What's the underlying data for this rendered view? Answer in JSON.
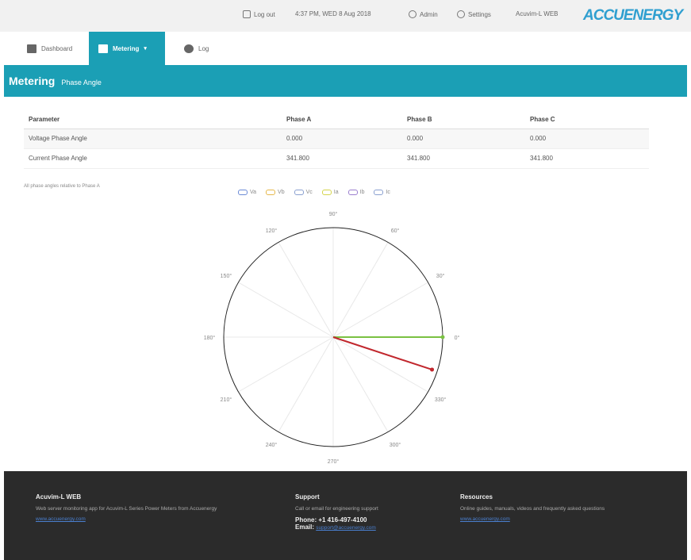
{
  "header": {
    "items": [
      {
        "label": "Log out",
        "icon": "logout-icon"
      },
      {
        "label": "4:37 PM, WED 8 Aug 2018",
        "icon": ""
      },
      {
        "label": "Admin",
        "icon": "info-icon"
      },
      {
        "label": "Settings",
        "icon": "gear-icon"
      },
      {
        "label": "Acuvim-L WEB",
        "icon": ""
      }
    ],
    "logo": "ACCUENERGY"
  },
  "nav": {
    "tabs": [
      {
        "label": "Dashboard",
        "icon": "dashboard-icon"
      },
      {
        "label": "Metering",
        "icon": "metering-icon",
        "caret": "▾"
      },
      {
        "label": "Log",
        "icon": "log-icon"
      }
    ]
  },
  "title": {
    "main": "Metering",
    "sub": "Phase Angle"
  },
  "table": {
    "headers": [
      "Parameter",
      "Phase A",
      "Phase B",
      "Phase C"
    ],
    "rows": [
      [
        "Voltage Phase Angle",
        "0.000",
        "0.000",
        "0.000"
      ],
      [
        "Current Phase Angle",
        "341.800",
        "341.800",
        "341.800"
      ]
    ]
  },
  "note": "All phase angles relative to Phase A",
  "chart_data": {
    "type": "polar",
    "legend": [
      {
        "name": "Va",
        "color": "#6b8bd6"
      },
      {
        "name": "Vb",
        "color": "#e6b84c"
      },
      {
        "name": "Vc",
        "color": "#8aa0d0"
      },
      {
        "name": "Ia",
        "color": "#d4d44c"
      },
      {
        "name": "Ib",
        "color": "#9b7fcf"
      },
      {
        "name": "Ic",
        "color": "#8aa0d0"
      }
    ],
    "angle_labels": [
      "90°",
      "60°",
      "30°",
      "0°",
      "330°",
      "300°",
      "270°",
      "240°",
      "210°",
      "180°",
      "150°",
      "120°"
    ],
    "angle_values": [
      90,
      60,
      30,
      0,
      330,
      300,
      270,
      240,
      210,
      180,
      150,
      120
    ],
    "vectors": [
      {
        "name": "voltage",
        "angle": 0,
        "magnitude": 1.0,
        "color": "#7ac142",
        "label": "Va/Vb/Vc"
      },
      {
        "name": "current",
        "angle": 341.8,
        "magnitude": 0.95,
        "color": "#c1272d",
        "label": "Ia"
      }
    ]
  },
  "footer": {
    "col1": {
      "heading": "Acuvim-L WEB",
      "text": "Web server monitoring app for Acuvim-L Series Power Meters from Accuenergy",
      "link": "www.accuenergy.com"
    },
    "col2": {
      "heading": "Support",
      "text": "Call or email for engineering support",
      "phone": "Phone: +1 416-497-4100",
      "email_label": "Email:",
      "email": "support@accuenergy.com"
    },
    "col3": {
      "heading": "Resources",
      "text": "Online guides, manuals, videos and frequently asked questions",
      "link": "www.accuenergy.com"
    }
  }
}
